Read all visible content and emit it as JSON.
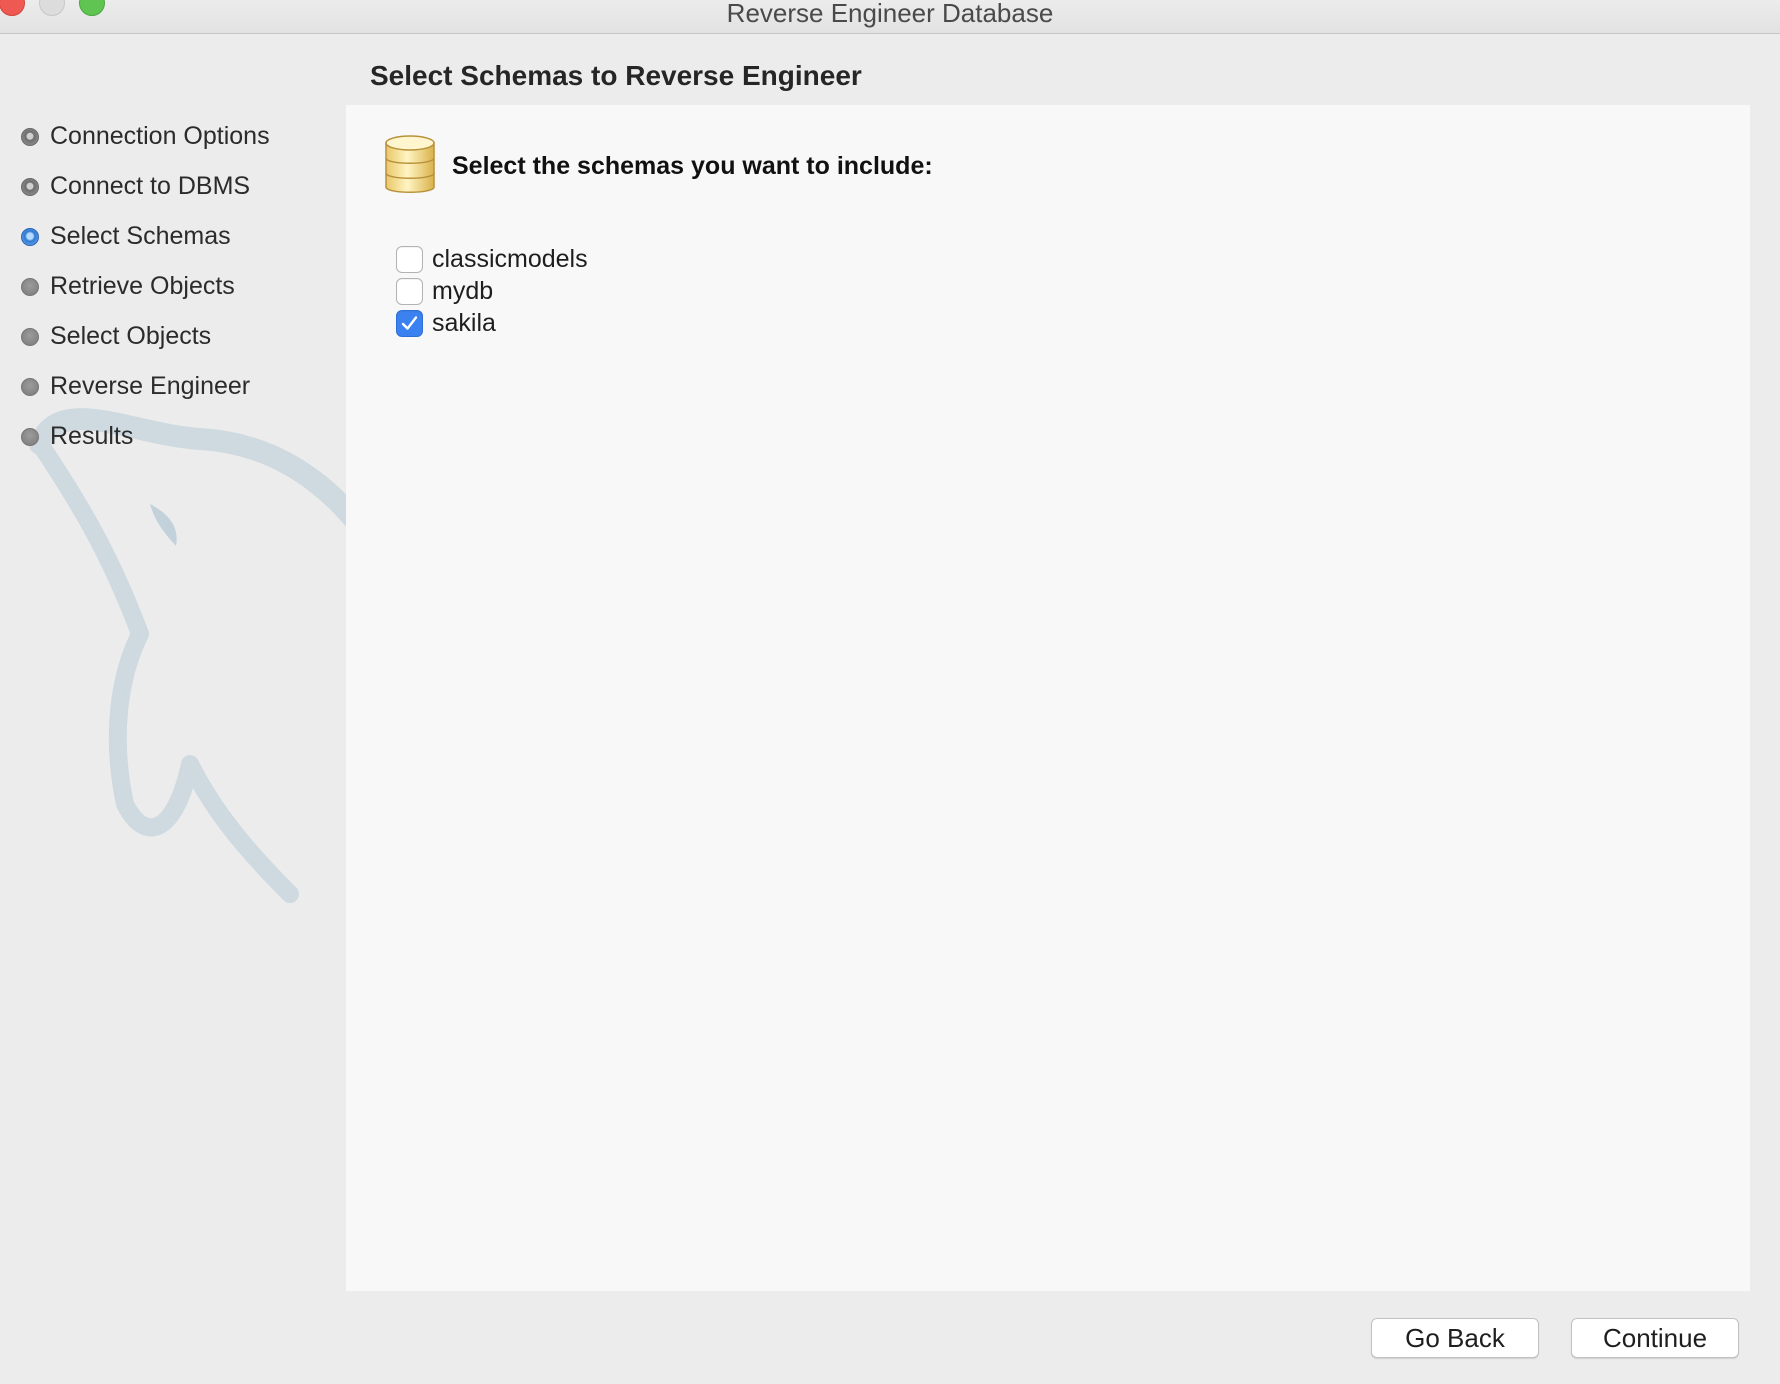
{
  "window": {
    "title": "Reverse Engineer Database"
  },
  "sidebar": {
    "steps": [
      {
        "label": "Connection Options",
        "state": "done"
      },
      {
        "label": "Connect to DBMS",
        "state": "done"
      },
      {
        "label": "Select Schemas",
        "state": "current"
      },
      {
        "label": "Retrieve Objects",
        "state": "pending"
      },
      {
        "label": "Select Objects",
        "state": "pending"
      },
      {
        "label": "Reverse Engineer",
        "state": "pending"
      },
      {
        "label": "Results",
        "state": "pending"
      }
    ]
  },
  "main": {
    "title": "Select Schemas to Reverse Engineer",
    "prompt": "Select the schemas you want to include:",
    "icon": "database-icon",
    "schemas": [
      {
        "name": "classicmodels",
        "checked": false
      },
      {
        "name": "mydb",
        "checked": false
      },
      {
        "name": "sakila",
        "checked": true
      }
    ]
  },
  "footer": {
    "back_label": "Go Back",
    "continue_label": "Continue"
  },
  "colors": {
    "accent": "#3b82f0",
    "close": "#ee5a52",
    "zoom": "#5fc452",
    "panel": "#f9f9f9",
    "background": "#ececec"
  }
}
